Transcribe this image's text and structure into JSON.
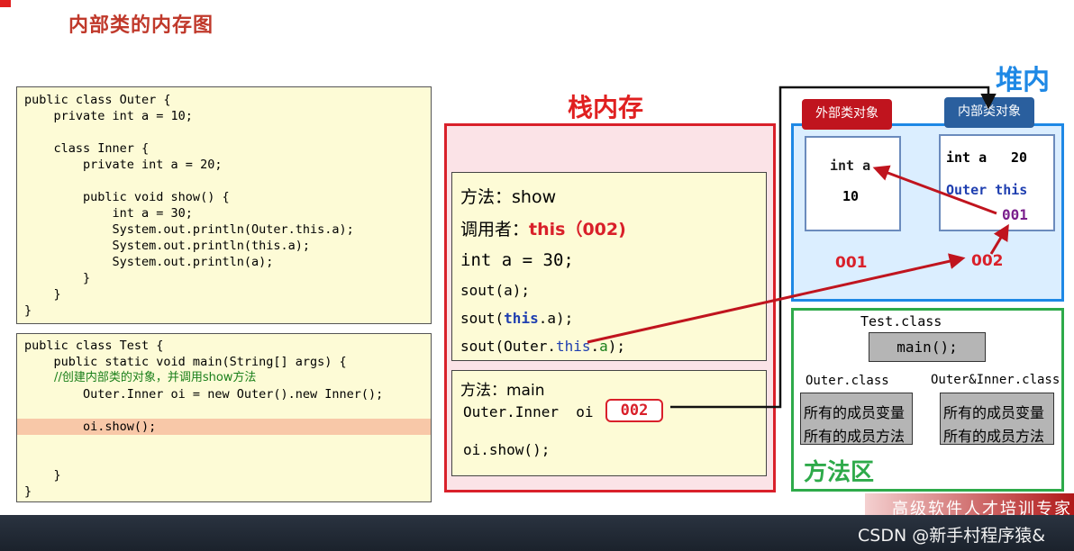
{
  "page_title": "内部类的内存图",
  "code_outer": [
    "public class Outer {",
    "    private int a = 10;",
    "",
    "    class Inner {",
    "        private int a = 20;",
    "",
    "        public void show() {",
    "            int a = 30;",
    "            System.out.println(Outer.this.a);",
    "            System.out.println(this.a);",
    "            System.out.println(a);",
    "        }",
    "    }",
    "}"
  ],
  "code_test": [
    "public class Test {",
    "    public static void main(String[] args) {",
    "        //创建内部类的对象，并调用show方法",
    "        Outer.Inner oi = new Outer().new Inner();",
    "",
    "        oi.show();",
    "",
    "",
    "    }",
    "}"
  ],
  "stack": {
    "title": "栈内存",
    "show_frame": {
      "method_label": "方法：show",
      "caller_label": "调用者：",
      "caller_value": "this（002)",
      "local_var": "int a = 30;",
      "line1": "sout(a);",
      "line2_prefix": "sout(",
      "line2_this": "this",
      "line2_suffix": ".a);",
      "line3_prefix": "sout(Outer.",
      "line3_this": "this",
      "line3_mid": ".",
      "line3_a": "a",
      "line3_suffix": ");"
    },
    "main_frame": {
      "method_label": "方法：main",
      "var_decl": "Outer.Inner  oi",
      "var_value": "002",
      "call": "oi.show();"
    }
  },
  "heap": {
    "title": "堆内存",
    "outer_tag": "外部类对象",
    "inner_tag": "内部类对象",
    "outer_obj": {
      "field": "int a",
      "value": "10"
    },
    "inner_obj": {
      "field": "int a",
      "value": "20",
      "ref": "Outer this",
      "ref_value": "001"
    },
    "addr_outer": "001",
    "addr_inner": "002"
  },
  "method_area": {
    "title": "方法区",
    "test_class": "Test.class",
    "test_method": "main();",
    "outer_class": "Outer.class",
    "inner_class": "Outer&Inner.class",
    "members_vars": "所有的成员变量",
    "members_methods": "所有的成员方法"
  },
  "watermark": {
    "banner_text": "高级软件人才培训专家",
    "csdn": "CSDN @新手村程序猿&"
  },
  "colors": {
    "title_red": "#c0392b",
    "stack_red": "#d9202a",
    "heap_blue": "#1e88e5",
    "method_green": "#2eaa4a",
    "code_bg": "#fdfbd6",
    "arrow_red": "#c0141e"
  }
}
